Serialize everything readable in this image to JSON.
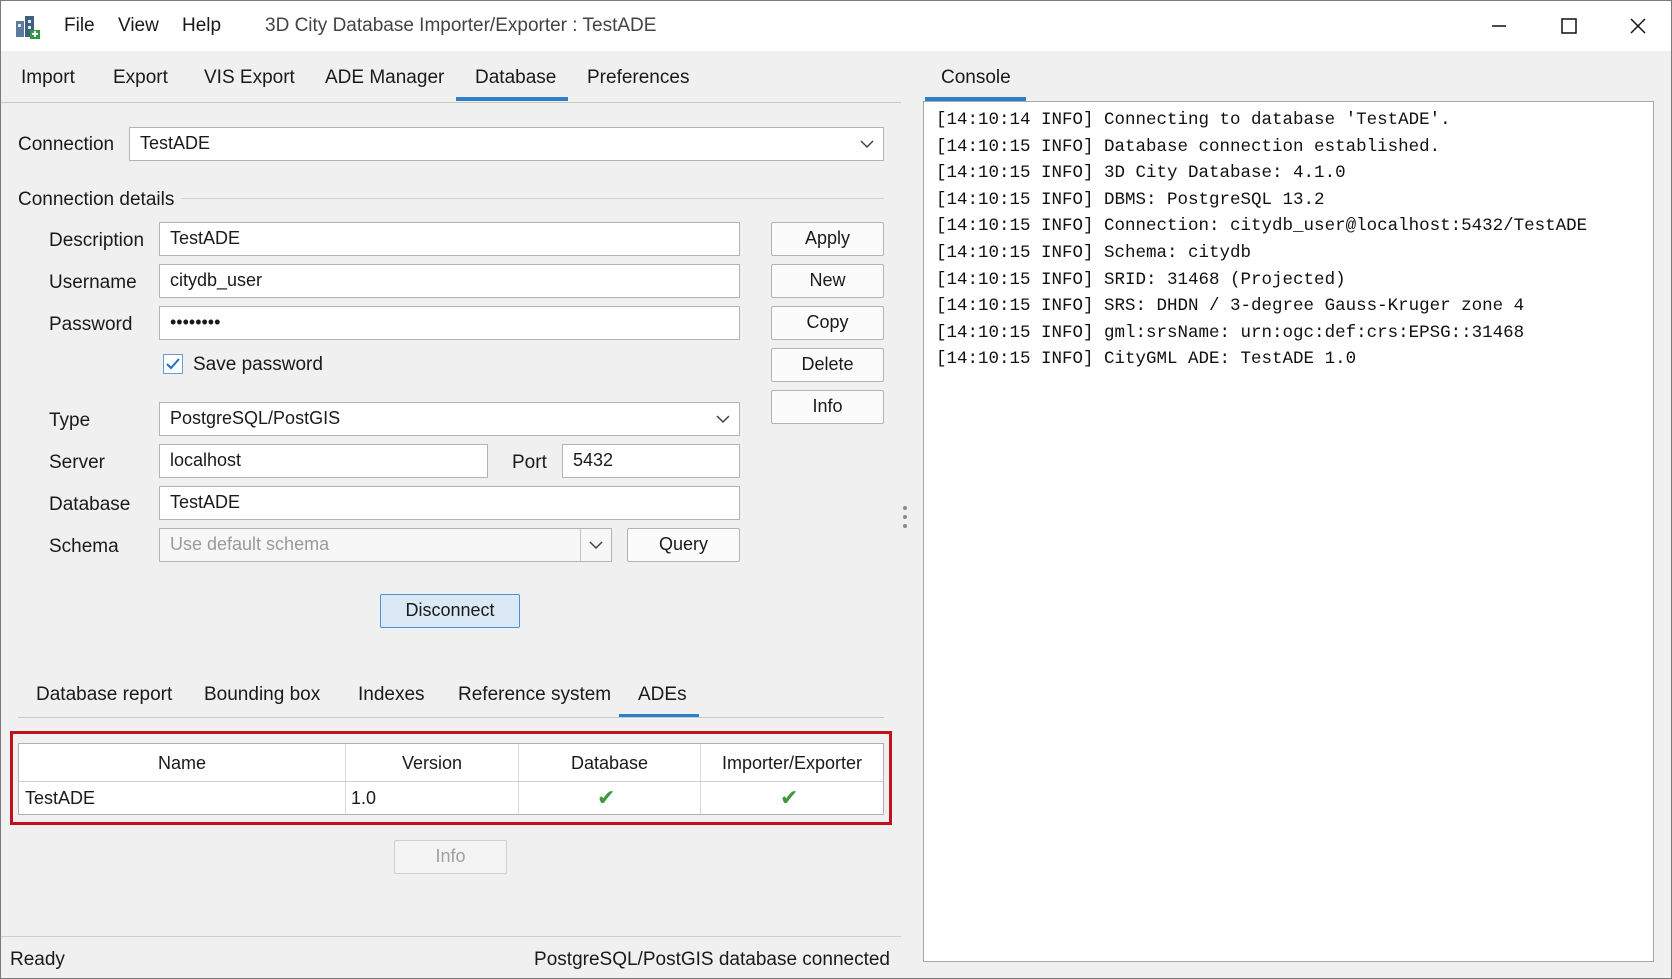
{
  "menu": {
    "file": "File",
    "view": "View",
    "help": "Help"
  },
  "window": {
    "title": "3D City Database Importer/Exporter : TestADE"
  },
  "tabs": [
    "Import",
    "Export",
    "VIS Export",
    "ADE Manager",
    "Database",
    "Preferences"
  ],
  "console": {
    "tab": "Console",
    "lines": [
      "[14:10:14 INFO] Connecting to database 'TestADE'.",
      "[14:10:15 INFO] Database connection established.",
      "[14:10:15 INFO] 3D City Database: 4.1.0",
      "[14:10:15 INFO] DBMS: PostgreSQL 13.2",
      "[14:10:15 INFO] Connection: citydb_user@localhost:5432/TestADE",
      "[14:10:15 INFO] Schema: citydb",
      "[14:10:15 INFO] SRID: 31468 (Projected)",
      "[14:10:15 INFO] SRS: DHDN / 3-degree Gauss-Kruger zone 4",
      "[14:10:15 INFO] gml:srsName: urn:ogc:def:crs:EPSG::31468",
      "[14:10:15 INFO] CityGML ADE: TestADE 1.0"
    ]
  },
  "connection": {
    "label": "Connection",
    "value": "TestADE"
  },
  "details": {
    "title": "Connection details",
    "description_label": "Description",
    "description_value": "TestADE",
    "username_label": "Username",
    "username_value": "citydb_user",
    "password_label": "Password",
    "password_value": "••••••••",
    "save_password_label": "Save password",
    "save_password_checked": true,
    "type_label": "Type",
    "type_value": "PostgreSQL/PostGIS",
    "server_label": "Server",
    "server_value": "localhost",
    "port_label": "Port",
    "port_value": "5432",
    "database_label": "Database",
    "database_value": "TestADE",
    "schema_label": "Schema",
    "schema_placeholder": "Use default schema"
  },
  "buttons": {
    "apply": "Apply",
    "new": "New",
    "copy": "Copy",
    "delete": "Delete",
    "info": "Info",
    "query": "Query",
    "disconnect": "Disconnect",
    "ade_info": "Info"
  },
  "subtabs": [
    "Database report",
    "Bounding box",
    "Indexes",
    "Reference system",
    "ADEs"
  ],
  "ade_table": {
    "headers": [
      "Name",
      "Version",
      "Database",
      "Importer/Exporter"
    ],
    "rows": [
      {
        "name": "TestADE",
        "version": "1.0",
        "database": "✔",
        "importer_exporter": "✔"
      }
    ]
  },
  "status": {
    "left": "Ready",
    "right": "PostgreSQL/PostGIS database connected"
  },
  "colors": {
    "accent": "#2c7fc9",
    "highlight_border": "#c0121c",
    "check": "#3c9a3c"
  }
}
